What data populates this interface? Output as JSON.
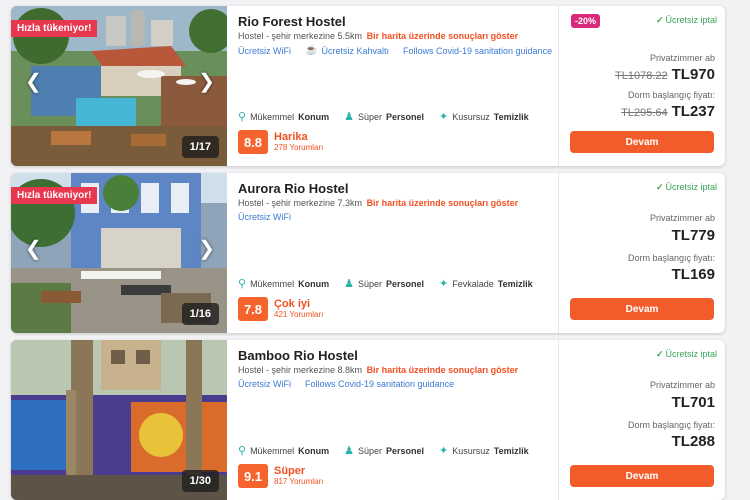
{
  "hostels": [
    {
      "badge": "Hızla tükeniyor!",
      "photo_counter": "1/17",
      "name": "Rio Forest Hostel",
      "distance": "Hostel - şehir merkezine 5.5km",
      "map_link": "Bir harita üzerinde sonuçları göster",
      "facilities": [
        "Ücretsiz WiFi",
        "Ücretsiz Kahvaltı",
        "Follows Covid-19 sanitation guidance"
      ],
      "features": [
        {
          "prefix": "Mükemmel",
          "bold": "Konum"
        },
        {
          "prefix": "Süper",
          "bold": "Personel"
        },
        {
          "prefix": "Kusursuz",
          "bold": "Temizlik"
        }
      ],
      "score": "8.8",
      "rating_label": "Harika",
      "reviews": "278 Yorumları",
      "discount": "-20%",
      "free_cancel": "Ücretsiz iptal",
      "private_label": "Privatzimmer ab",
      "private_old": "TL1078.22",
      "private_price": "TL970",
      "dorm_label": "Dorm başlangıç fiyatı:",
      "dorm_old": "TL295.64",
      "dorm_price": "TL237",
      "button": "Devam"
    },
    {
      "badge": "Hızla tükeniyor!",
      "photo_counter": "1/16",
      "name": "Aurora Rio Hostel",
      "distance": "Hostel - şehir merkezine 7.3km",
      "map_link": "Bir harita üzerinde sonuçları göster",
      "facilities": [
        "Ücretsiz WiFi"
      ],
      "features": [
        {
          "prefix": "Mükemmel",
          "bold": "Konum"
        },
        {
          "prefix": "Süper",
          "bold": "Personel"
        },
        {
          "prefix": "Fevkalade",
          "bold": "Temizlik"
        }
      ],
      "score": "7.8",
      "rating_label": "Çok iyi",
      "reviews": "421 Yorumları",
      "discount": "",
      "free_cancel": "Ücretsiz iptal",
      "private_label": "Privatzimmer ab",
      "private_old": "",
      "private_price": "TL779",
      "dorm_label": "Dorm başlangıç fiyatı:",
      "dorm_old": "",
      "dorm_price": "TL169",
      "button": "Devam"
    },
    {
      "badge": "",
      "photo_counter": "1/30",
      "name": "Bamboo Rio Hostel",
      "distance": "Hostel - şehir merkezine 8.8km",
      "map_link": "Bir harita üzerinde sonuçları göster",
      "facilities": [
        "Ücretsiz WiFi",
        "Follows Covid-19 sanitation guidance"
      ],
      "features": [
        {
          "prefix": "Mükemmel",
          "bold": "Konum"
        },
        {
          "prefix": "Süper",
          "bold": "Personel"
        },
        {
          "prefix": "Kusursuz",
          "bold": "Temizlik"
        }
      ],
      "score": "9.1",
      "rating_label": "Süper",
      "reviews": "817 Yorumları",
      "discount": "",
      "free_cancel": "Ücretsiz iptal",
      "private_label": "Privatzimmer ab",
      "private_old": "",
      "private_price": "TL701",
      "dorm_label": "Dorm başlangıç fiyatı:",
      "dorm_old": "",
      "dorm_price": "TL288",
      "button": "Devam"
    }
  ],
  "colors": {
    "accent": "#f25c2b",
    "score_bg": "#f4642c",
    "badge_red": "#e8384f",
    "discount_pink": "#d9297a",
    "free_cancel_green": "#3aa655",
    "facility_blue": "#3a7bd5",
    "feature_teal": "#2bb5a5"
  },
  "icons": {
    "location": "location-pin-icon",
    "staff": "people-icon",
    "cleanliness": "sparkle-icon",
    "breakfast": "coffee-cup-icon",
    "prev": "chevron-left-icon",
    "next": "chevron-right-icon",
    "check": "check-icon"
  }
}
